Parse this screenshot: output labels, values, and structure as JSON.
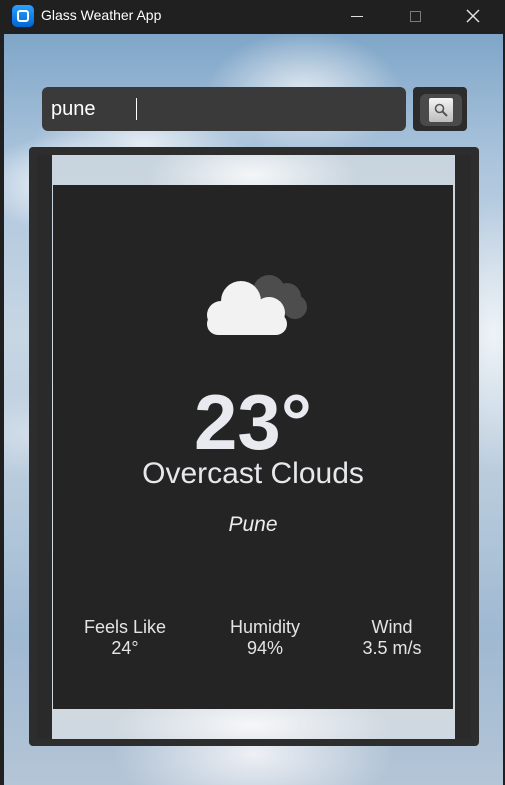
{
  "window": {
    "title": "Glass Weather App"
  },
  "search": {
    "value": "pune"
  },
  "icons": {
    "app": "app-icon",
    "minimize": "minimize-icon",
    "maximize": "maximize-icon",
    "close": "close-icon",
    "search": "search-icon",
    "weather": "cloud-icon"
  },
  "weather": {
    "temperature": "23°",
    "condition": "Overcast Clouds",
    "city": "Pune",
    "stats": [
      {
        "label": "Feels Like",
        "value": "24°"
      },
      {
        "label": "Humidity",
        "value": "94%"
      },
      {
        "label": "Wind",
        "value": "3.5 m/s"
      }
    ]
  },
  "colors": {
    "card": "#242424",
    "titlebar": "#202020",
    "search_field": "#3a3a3a",
    "text": "#e8eaf0"
  }
}
